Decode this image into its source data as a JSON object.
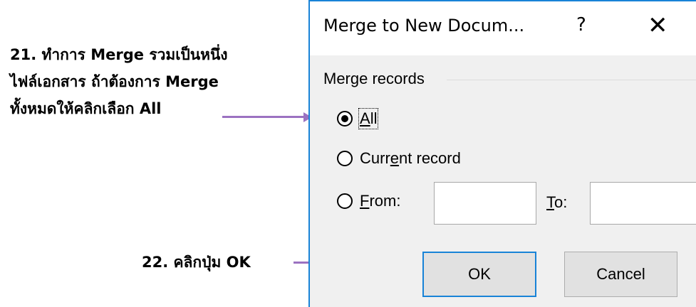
{
  "annotations": {
    "step21": {
      "line1": "21. ทำการ Merge รวมเป็นหนึ่ง",
      "line2": "ไฟล์เอกสาร  ถ้าต้องการ Merge",
      "line3": "ทั้งหมดให้คลิกเลือก All"
    },
    "step22": "22. คลิกปุ่ม OK"
  },
  "dialog": {
    "title": "Merge to New Docum...",
    "help_symbol": "?",
    "close_symbol": "✕",
    "group_label": "Merge records",
    "options": {
      "all": {
        "pre": "",
        "accel": "A",
        "post": "ll",
        "checked": true
      },
      "current": {
        "pre": "Curr",
        "accel": "e",
        "post": "nt record",
        "checked": false
      },
      "from": {
        "pre": "",
        "accel": "F",
        "post": "rom:",
        "checked": false
      }
    },
    "from_value": "",
    "to_label": {
      "accel": "T",
      "post": "o:"
    },
    "to_value": "",
    "ok_label": "OK",
    "cancel_label": "Cancel"
  },
  "colors": {
    "arrow": "#9b72c1",
    "dialog_border": "#1883d7",
    "dialog_bg": "#f0f0f0"
  },
  "icons": [
    "help-icon",
    "close-icon",
    "radio-icon"
  ]
}
